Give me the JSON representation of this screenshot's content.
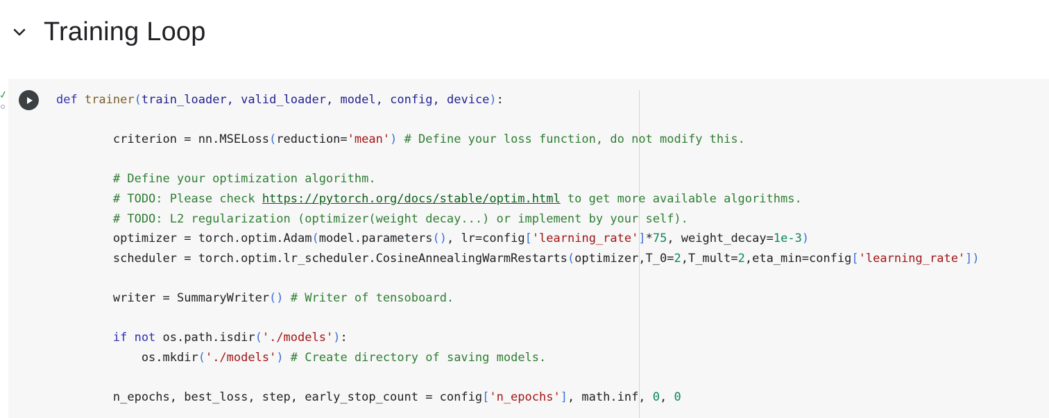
{
  "section": {
    "title": "Training Loop",
    "toggle_icon": "chevron-down-icon"
  },
  "cell": {
    "run_icon": "play-icon",
    "lines": [
      [
        {
          "t": "def ",
          "c": "kw"
        },
        {
          "t": "trainer",
          "c": "fn"
        },
        {
          "t": "(",
          "c": "br"
        },
        {
          "t": "train_loader, ",
          "c": "name"
        },
        {
          "t": "valid_loader, ",
          "c": "name"
        },
        {
          "t": "model, ",
          "c": "name"
        },
        {
          "t": "config, ",
          "c": "name"
        },
        {
          "t": "device",
          "c": "name"
        },
        {
          "t": ")",
          "c": "br"
        },
        {
          "t": ":",
          "c": "p"
        }
      ],
      [],
      [
        {
          "t": "        criterion = nn.MSELoss",
          "c": "p"
        },
        {
          "t": "(",
          "c": "br"
        },
        {
          "t": "reduction=",
          "c": "p"
        },
        {
          "t": "'mean'",
          "c": "str"
        },
        {
          "t": ")",
          "c": "br"
        },
        {
          "t": " # Define your loss function, do not modify this.",
          "c": "cm"
        }
      ],
      [],
      [
        {
          "t": "        # Define your optimization algorithm.",
          "c": "cm"
        }
      ],
      [
        {
          "t": "        # TODO: Please check ",
          "c": "cm"
        },
        {
          "t": "https://pytorch.org/docs/stable/optim.html",
          "c": "link"
        },
        {
          "t": " to get more available algorithms.",
          "c": "cm"
        }
      ],
      [
        {
          "t": "        # TODO: L2 regularization (optimizer(weight decay...) or implement by your self).",
          "c": "cm"
        }
      ],
      [
        {
          "t": "        optimizer = torch.optim.Adam",
          "c": "p"
        },
        {
          "t": "(",
          "c": "br"
        },
        {
          "t": "model.parameters",
          "c": "p"
        },
        {
          "t": "()",
          "c": "br"
        },
        {
          "t": ", lr=config",
          "c": "p"
        },
        {
          "t": "[",
          "c": "br"
        },
        {
          "t": "'learning_rate'",
          "c": "str"
        },
        {
          "t": "]",
          "c": "br"
        },
        {
          "t": "*",
          "c": "p"
        },
        {
          "t": "75",
          "c": "num"
        },
        {
          "t": ", weight_decay=",
          "c": "p"
        },
        {
          "t": "1e-3",
          "c": "num"
        },
        {
          "t": ")",
          "c": "br"
        }
      ],
      [
        {
          "t": "        scheduler = torch.optim.lr_scheduler.CosineAnnealingWarmRestarts",
          "c": "p"
        },
        {
          "t": "(",
          "c": "br"
        },
        {
          "t": "optimizer,T_0=",
          "c": "p"
        },
        {
          "t": "2",
          "c": "num"
        },
        {
          "t": ",T_mult=",
          "c": "p"
        },
        {
          "t": "2",
          "c": "num"
        },
        {
          "t": ",eta_min=config",
          "c": "p"
        },
        {
          "t": "[",
          "c": "br"
        },
        {
          "t": "'learning_rate'",
          "c": "str"
        },
        {
          "t": "])",
          "c": "br"
        }
      ],
      [],
      [
        {
          "t": "        writer = SummaryWriter",
          "c": "p"
        },
        {
          "t": "()",
          "c": "br"
        },
        {
          "t": " # Writer of tensoboard.",
          "c": "cm"
        }
      ],
      [],
      [
        {
          "t": "        if not",
          "c": "kw"
        },
        {
          "t": " os.path.isdir",
          "c": "p"
        },
        {
          "t": "(",
          "c": "br"
        },
        {
          "t": "'./models'",
          "c": "str"
        },
        {
          "t": ")",
          "c": "br"
        },
        {
          "t": ":",
          "c": "p"
        }
      ],
      [
        {
          "t": "            os.mkdir",
          "c": "p"
        },
        {
          "t": "(",
          "c": "br"
        },
        {
          "t": "'./models'",
          "c": "str"
        },
        {
          "t": ")",
          "c": "br"
        },
        {
          "t": " # Create directory of saving models.",
          "c": "cm"
        }
      ],
      [],
      [
        {
          "t": "        n_epochs, best_loss, step, early_stop_count = config",
          "c": "p"
        },
        {
          "t": "[",
          "c": "br"
        },
        {
          "t": "'n_epochs'",
          "c": "str"
        },
        {
          "t": "]",
          "c": "br"
        },
        {
          "t": ", math.inf, ",
          "c": "p"
        },
        {
          "t": "0",
          "c": "num"
        },
        {
          "t": ", ",
          "c": "p"
        },
        {
          "t": "0",
          "c": "num"
        }
      ]
    ]
  }
}
